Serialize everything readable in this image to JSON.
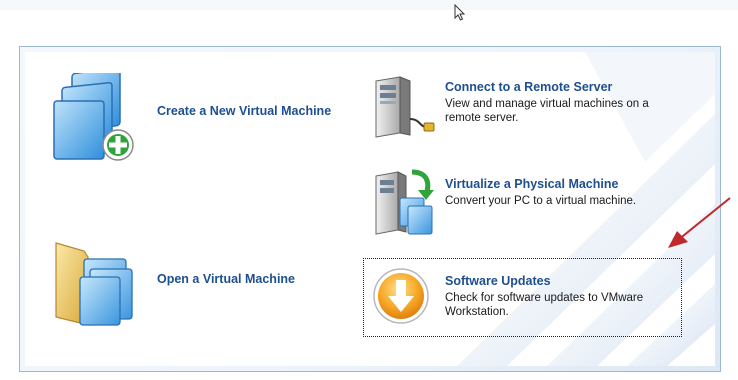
{
  "actions": {
    "create_vm": {
      "label": "Create a New Virtual Machine",
      "icon": "new-vm-icon"
    },
    "open_vm": {
      "label": "Open a Virtual Machine",
      "icon": "folder-vm-icon"
    },
    "connect_remote": {
      "title": "Connect to a Remote Server",
      "desc": "View and manage virtual machines on a remote server.",
      "icon": "server-plug-icon"
    },
    "virtualize_physical": {
      "title": "Virtualize a Physical Machine",
      "desc": "Convert your PC to a virtual machine.",
      "icon": "server-convert-icon"
    },
    "software_updates": {
      "title": "Software Updates",
      "desc": "Check for software updates to VMware Workstation.",
      "icon": "update-arrow-icon"
    }
  },
  "colors": {
    "link_blue": "#1e4f8f",
    "annotation_red": "#c0282a",
    "update_orange": "#f29a1c"
  }
}
